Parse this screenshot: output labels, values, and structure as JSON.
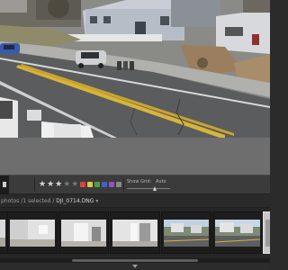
{
  "toolbar": {
    "rating_stars": "★★★",
    "rating_dim_stars": "★★",
    "show_grid_label": "Show Grid:",
    "show_grid_value": "Auto",
    "colors": [
      "#e04040",
      "#e0c840",
      "#50a040",
      "#4060d0",
      "#9050c0",
      "#888888"
    ]
  },
  "filmstrip_header": {
    "prefix": "photos /1 selected /",
    "filename": "DJI_0714.DNG",
    "caret": "▾"
  },
  "thumbnails": [
    {
      "kind": "interior",
      "selected": false
    },
    {
      "kind": "interior",
      "selected": false
    },
    {
      "kind": "interior",
      "selected": false
    },
    {
      "kind": "interior",
      "selected": false
    },
    {
      "kind": "aerial",
      "selected": false
    },
    {
      "kind": "aerial",
      "selected": true
    }
  ]
}
